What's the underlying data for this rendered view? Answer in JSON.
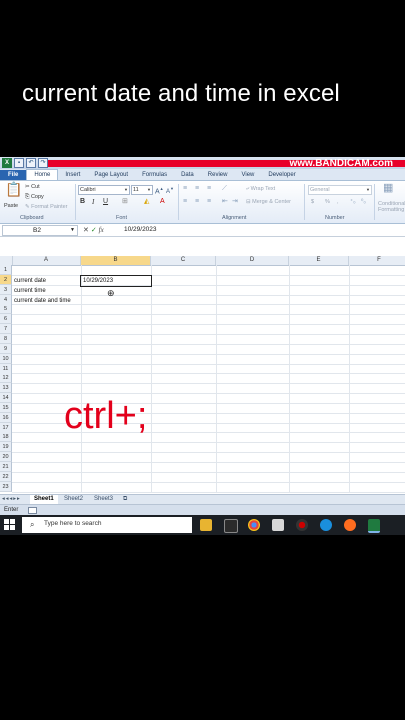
{
  "caption": "current date and time in excel",
  "watermark": "www.BANDICAM.com",
  "ribbon_tabs": [
    "File",
    "Home",
    "Insert",
    "Page Layout",
    "Formulas",
    "Data",
    "Review",
    "View",
    "Developer"
  ],
  "ribbon": {
    "clipboard": {
      "cut": "Cut",
      "copy": "Copy",
      "paste": "Paste",
      "format_painter": "Format Painter",
      "label": "Clipboard"
    },
    "font": {
      "name": "Calibri",
      "size": "11",
      "bold": "B",
      "italic": "I",
      "underline": "U",
      "label": "Font"
    },
    "alignment": {
      "wrap": "Wrap Text",
      "merge": "Merge & Center",
      "label": "Alignment"
    },
    "number": {
      "format": "General",
      "currency": "$",
      "percent": "%",
      "comma": ",",
      "label": "Number"
    },
    "styles": {
      "conditional": "Conditional Formatting"
    }
  },
  "formula_bar": {
    "name_box": "B2",
    "fx": "fx",
    "content": "10/29/2023"
  },
  "columns": [
    "A",
    "B",
    "C",
    "D",
    "E",
    "F"
  ],
  "rows": [
    "1",
    "2",
    "3",
    "4",
    "5",
    "6",
    "7",
    "8",
    "9",
    "10",
    "11",
    "12",
    "13",
    "14",
    "15",
    "16",
    "17",
    "18",
    "19",
    "20",
    "21",
    "22",
    "23"
  ],
  "cells": {
    "A2": "current date",
    "A3": "current time",
    "A4": "current date and time",
    "B2": "10/29/2023"
  },
  "overlay_text": "ctrl+;",
  "sheet_tabs": [
    "Sheet1",
    "Sheet2",
    "Sheet3"
  ],
  "status": {
    "mode": "Enter"
  },
  "taskbar": {
    "search_placeholder": "Type here to search"
  },
  "colors": {
    "overlay": "#e3001b",
    "accent": "#2a65b0",
    "selection": "#f7d88b"
  }
}
